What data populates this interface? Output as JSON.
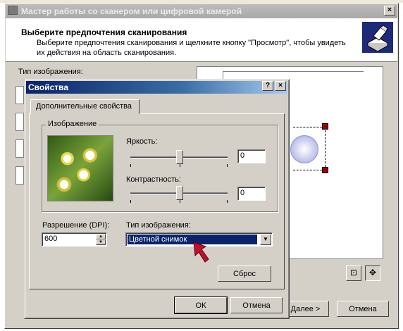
{
  "wizard": {
    "title": "Мастер работы со сканером или цифровой камерой",
    "header_title": "Выберите предпочтения сканирования",
    "header_subtitle": "Выберите предпочтения сканирования и щелкните кнопку \"Просмотр\", чтобы увидеть их действия на область сканирования.",
    "image_type_label": "Тип изображения:",
    "next_button": "Далее >",
    "cancel_button": "Отмена"
  },
  "dialog": {
    "title": "Свойства",
    "help_button": "?",
    "close_button": "×",
    "tab_label": "Дополнительные свойства",
    "group_label": "Изображение",
    "brightness_label": "Яркость:",
    "brightness_value": "0",
    "contrast_label": "Контрастность:",
    "contrast_value": "0",
    "resolution_label": "Разрешение (DPI):",
    "resolution_value": "600",
    "image_type_label": "Тип изображения:",
    "image_type_value": "Цветной снимок",
    "reset_button": "Сброс",
    "ok_button": "ОК",
    "cancel_button": "Отмена"
  }
}
